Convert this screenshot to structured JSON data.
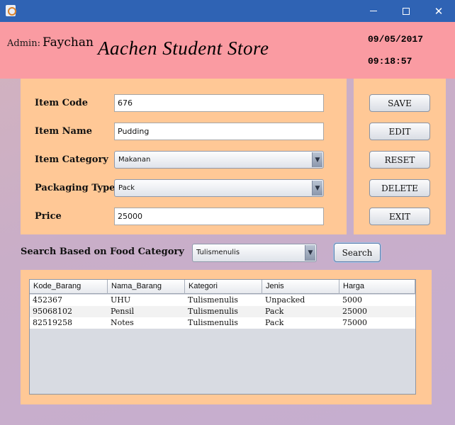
{
  "window": {
    "minimize": "—",
    "maximize": "☐",
    "close": "✕"
  },
  "header": {
    "admin_label": "Admin:",
    "admin_name": "Faychan",
    "store_title": "Aachen Student Store",
    "date": "09/05/2017",
    "time": "09:18:57"
  },
  "form": {
    "item_code": {
      "label": "Item Code",
      "value": "676"
    },
    "item_name": {
      "label": "Item Name",
      "value": "Pudding"
    },
    "item_category": {
      "label": "Item Category",
      "value": "Makanan"
    },
    "packaging_type": {
      "label": "Packaging Type",
      "value": "Pack"
    },
    "price": {
      "label": "Price",
      "value": "25000"
    }
  },
  "buttons": {
    "save": "SAVE",
    "edit": "EDIT",
    "reset": "RESET",
    "delete": "DELETE",
    "exit": "EXIT"
  },
  "search": {
    "label": "Search Based on Food Category",
    "category": "Tulismenulis",
    "button": "Search"
  },
  "table": {
    "columns": [
      "Kode_Barang",
      "Nama_Barang",
      "Kategori",
      "Jenis",
      "Harga"
    ],
    "rows": [
      [
        "452367",
        "UHU",
        "Tulismenulis",
        "Unpacked",
        "5000"
      ],
      [
        "95068102",
        "Pensil",
        "Tulismenulis",
        "Pack",
        "25000"
      ],
      [
        "82519258",
        "Notes",
        "Tulismenulis",
        "Pack",
        "75000"
      ]
    ]
  },
  "colors": {
    "titlebar": "#2f63b4",
    "header": "#fa9ba2",
    "panel": "#ffc896"
  }
}
